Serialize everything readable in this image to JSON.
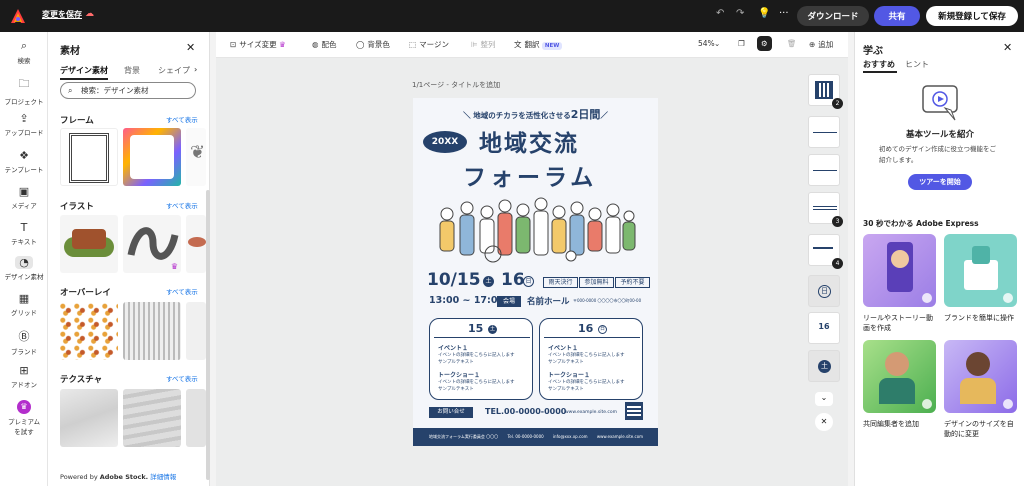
{
  "topbar": {
    "save_label": "変更を保存",
    "download_label": "ダウンロード",
    "share_label": "共有",
    "signup_label": "新規登録して保存"
  },
  "rail": {
    "items": [
      {
        "label": "検索",
        "icon": "search-icon"
      },
      {
        "label": "プロジェクト",
        "icon": "folder-icon"
      },
      {
        "label": "アップロード",
        "icon": "upload-icon"
      },
      {
        "label": "テンプレート",
        "icon": "template-icon"
      },
      {
        "label": "メディア",
        "icon": "media-icon"
      },
      {
        "label": "テキスト",
        "icon": "text-icon"
      },
      {
        "label": "デザイン素材",
        "icon": "shapes-icon"
      },
      {
        "label": "グリッド",
        "icon": "grid-icon"
      },
      {
        "label": "ブランド",
        "icon": "brand-icon"
      },
      {
        "label": "アドオン",
        "icon": "addon-icon"
      },
      {
        "label": "プレミアム",
        "label2": "を試す",
        "icon": "crown-icon"
      }
    ]
  },
  "panel": {
    "title": "素材",
    "tabs": [
      "デザイン素材",
      "背景",
      "シェイプ"
    ],
    "search_placeholder": "検索：デザイン素材",
    "sections": [
      {
        "title": "フレーム",
        "more": "すべて表示"
      },
      {
        "title": "イラスト",
        "more": "すべて表示"
      },
      {
        "title": "オーバーレイ",
        "more": "すべて表示"
      },
      {
        "title": "テクスチャ",
        "more": "すべて表示"
      }
    ],
    "powered_prefix": "Powered by ",
    "powered_brand": "Adobe Stock.",
    "powered_link": "詳細情報"
  },
  "toolbar": {
    "resize": "サイズ変更",
    "color": "配色",
    "bg_color": "背景色",
    "margin": "マージン",
    "arrange": "整列",
    "translate": "翻訳",
    "new_badge": "NEW",
    "zoom": "54%",
    "add": "追加"
  },
  "canvas": {
    "page_label": "1/1ページ - タイトルを追加",
    "page_thumbs": [
      "2",
      "",
      "",
      "3",
      "4",
      "日",
      "16",
      "土"
    ]
  },
  "poster": {
    "tagline": "＼ 地域のチカラを活性化させる",
    "tagline_days": "2日間",
    "tagline_end": "／",
    "year_badge": "20XX",
    "title1": "地域交流",
    "title2": "フォーラム",
    "date_main": "10/15",
    "dow1": "土",
    "date_second": "16",
    "dow2": "日",
    "tags": [
      "雨天決行",
      "参加無料",
      "予約不要"
    ],
    "time": "13:00 ~ 17:00",
    "venue_badge": "会場",
    "venue": "名前ホール",
    "address": "〒000-0000 〇〇〇〇市〇〇町00-00",
    "day1": "15",
    "day1_dow": "土",
    "day2": "16",
    "day2_dow": "日",
    "event_title": "イベント１",
    "event_text": "イベントの詳細をこちらに記入します",
    "event_sample": "サンプルテキスト",
    "talk_title": "トークショー１",
    "contact_badge": "お問い合せ",
    "tel": "TEL.00-0000-0000",
    "site": "www.example.site.com",
    "footer_org": "地域交流フォーラム実行委員会 〇〇〇",
    "footer_tel": "Tel. 00-0000-0000",
    "footer_mail": "info@xxx.xp.com",
    "footer_site": "www.example.site.com"
  },
  "learn": {
    "title": "学ぶ",
    "tabs": [
      "おすすめ",
      "ヒント"
    ],
    "card_title": "基本ツールを紹介",
    "card_text": "初めてのデザイン作成に役立つ機能をご紹介します。",
    "tour_button": "ツアーを開始",
    "section": "30 秒でわかる Adobe Express",
    "items": [
      "リールやストーリー動画を作成",
      "ブランドを簡単に操作",
      "共同編集者を追加",
      "デザインのサイズを自動的に変更"
    ]
  },
  "colors": {
    "navy": "#26426b",
    "accent": "#5258e4",
    "link": "#1473e6"
  }
}
